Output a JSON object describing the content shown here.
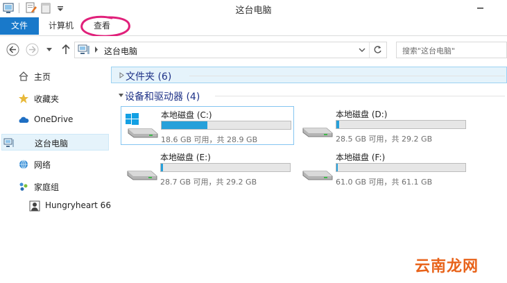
{
  "window": {
    "title": "这台电脑"
  },
  "ribbon": {
    "file_tab": "文件",
    "computer_tab": "计算机",
    "view_tab": "查看"
  },
  "address": {
    "location": "这台电脑",
    "search_placeholder": "搜索\"这台电脑\""
  },
  "sidebar": {
    "items": [
      {
        "label": "主页",
        "icon": "home-icon"
      },
      {
        "label": "收藏夹",
        "icon": "star-icon"
      },
      {
        "label": "OneDrive",
        "icon": "cloud-icon"
      },
      {
        "label": "这台电脑",
        "icon": "computer-icon",
        "selected": true
      },
      {
        "label": "网络",
        "icon": "network-icon"
      },
      {
        "label": "家庭组",
        "icon": "homegroup-icon"
      },
      {
        "label": "Hungryheart 66",
        "icon": "user-icon"
      }
    ]
  },
  "content": {
    "folders_group": "文件夹 (6)",
    "devices_group": "设备和驱动器 (4)",
    "drives": [
      {
        "name": "本地磁盘 (C:)",
        "free_text": "18.6 GB 可用，共 28.9 GB",
        "used_fraction": 0.356,
        "selected": true
      },
      {
        "name": "本地磁盘 (D:)",
        "free_text": "28.5 GB 可用，共 29.2 GB",
        "used_fraction": 0.024
      },
      {
        "name": "本地磁盘 (E:)",
        "free_text": "28.7 GB 可用，共 29.2 GB",
        "used_fraction": 0.017
      },
      {
        "name": "本地磁盘 (F:)",
        "free_text": "61.0 GB 可用，共 61.1 GB",
        "used_fraction": 0.002
      }
    ]
  },
  "colors": {
    "accent": "#1979ca",
    "bar_fill": "#26a0da",
    "annotation": "#e0207a",
    "watermark": "#e8631a"
  },
  "watermark": "云南龙网"
}
